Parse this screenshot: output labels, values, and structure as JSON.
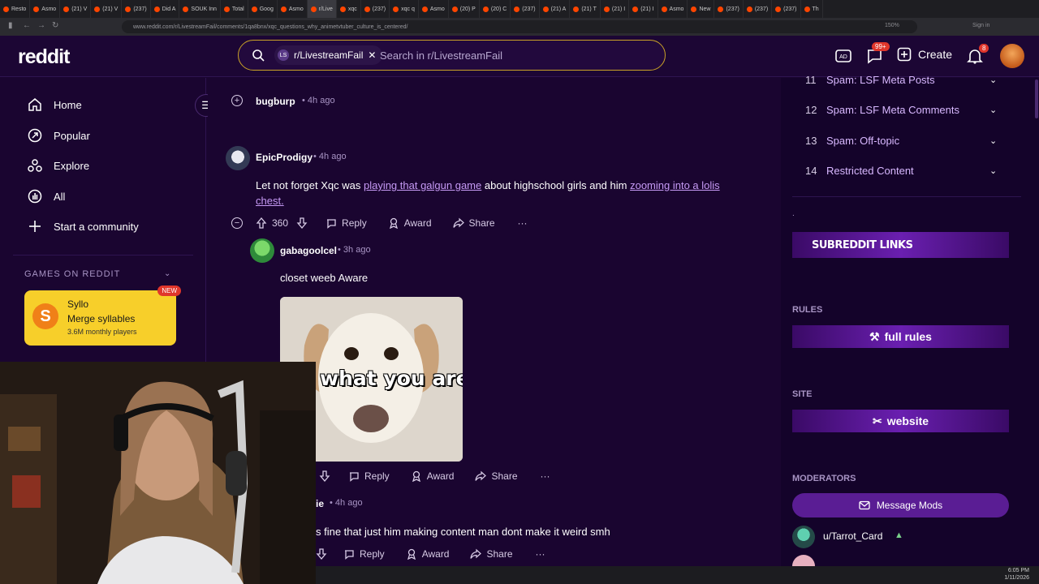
{
  "browser": {
    "tabs": [
      "Resto",
      "Asmo",
      "(21) V",
      "(21) V",
      "(237)",
      "Did A",
      "SOUK Inn",
      "Total",
      "Goog",
      "Asmo",
      "r/Live",
      "xqc",
      "(237)",
      "xqc q",
      "Asmo",
      "(20) P",
      "(20) C",
      "(237)",
      "(21) A",
      "(21) T",
      "(21) I",
      "(21) I",
      "Asmo",
      "New",
      "(237)",
      "(237)",
      "(237)",
      "Th"
    ],
    "url": "www.reddit.com/r/LivestreamFail/comments/1qa8bnx/xqc_questions_why_animetvtuber_culture_is_centered/",
    "zoom": "150%",
    "signin": "Sign in"
  },
  "header": {
    "logo": "reddit",
    "search_chip": "r/LivestreamFail",
    "search_chip_badge": "LS",
    "search_placeholder": "Search in r/LivestreamFail",
    "chat_badge": "99+",
    "notif_badge": "8",
    "create_label": "Create"
  },
  "leftnav": {
    "items": [
      {
        "label": "Home",
        "icon": "home-icon"
      },
      {
        "label": "Popular",
        "icon": "popular-icon"
      },
      {
        "label": "Explore",
        "icon": "explore-icon"
      },
      {
        "label": "All",
        "icon": "all-icon"
      },
      {
        "label": "Start a community",
        "icon": "plus-icon"
      }
    ],
    "games_header": "GAMES ON REDDIT",
    "game": {
      "logo": "S",
      "title": "Syllo",
      "subtitle": "Merge syllables",
      "players": "3.6M monthly players",
      "badge": "NEW"
    }
  },
  "comments": [
    {
      "user": "bugburp",
      "time": "4h ago"
    },
    {
      "user": "EpicProdigy",
      "time": "4h ago",
      "text_before": "Let not forget Xqc was ",
      "link1": "playing that galgun game",
      "text_middle": " about highschool girls and him ",
      "link2": "zooming into a lolis chest.",
      "votes": "360",
      "reply": "Reply",
      "award": "Award",
      "share": "Share"
    },
    {
      "user": "gabagoolcel",
      "time": "3h ago",
      "text": "closet weeb Aware",
      "meme_caption": "ow what you are",
      "reply": "Reply",
      "award": "Award",
      "share": "Share"
    },
    {
      "user": "ie",
      "time": "4h ago",
      "text": "s fine that just him making content man dont make it weird smh",
      "reply": "Reply",
      "award": "Award",
      "share": "Share"
    }
  ],
  "rightbar": {
    "rules": [
      {
        "num": "11",
        "label": "Spam: LSF Meta Posts"
      },
      {
        "num": "12",
        "label": "Spam: LSF Meta Comments"
      },
      {
        "num": "13",
        "label": "Spam: Off-topic"
      },
      {
        "num": "14",
        "label": "Restricted Content"
      }
    ],
    "dot": ".",
    "subreddit_links": "SUBREDDIT LINKS",
    "rules_header": "RULES",
    "full_rules": "full rules",
    "site_header": "SITE",
    "website": "website",
    "moderators_header": "MODERATORS",
    "message_mods": "Message Mods",
    "mod": "u/Tarrot_Card"
  },
  "taskbar": {
    "time": "6:05 PM",
    "date": "1/11/2026"
  },
  "colors": {
    "bg": "#1a0530",
    "accent": "#6a1fb0",
    "link": "#c69af5",
    "search_border": "#c9a227"
  }
}
